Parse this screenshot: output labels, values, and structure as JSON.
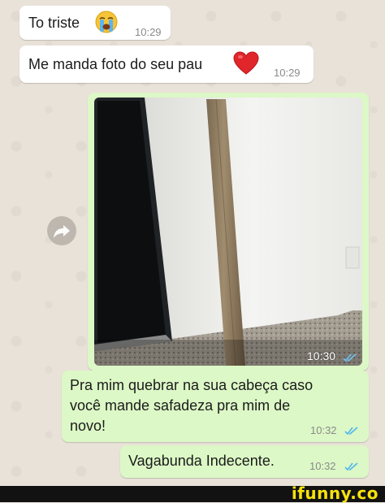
{
  "messages": [
    {
      "text": "To triste",
      "emoji": "crying-face",
      "time": "10:29"
    },
    {
      "text": "Me manda foto do seu pau",
      "emoji": "red-heart",
      "time": "10:29"
    },
    {
      "type": "photo",
      "time": "10:30",
      "status": "read"
    },
    {
      "lines": [
        "Pra mim quebrar na sua cabeça caso",
        "você mande safadeza pra mim de",
        "novo!"
      ],
      "time": "10:32",
      "status": "read"
    },
    {
      "text": "Vagabunda Indecente.",
      "time": "10:32",
      "status": "read"
    }
  ],
  "watermark": "ifunny.co",
  "colors": {
    "incoming": "#ffffff",
    "outgoing": "#dcf8c6",
    "read_ticks": "#4fb6ec",
    "footer": "#121212",
    "watermark": "#f5e20b"
  }
}
